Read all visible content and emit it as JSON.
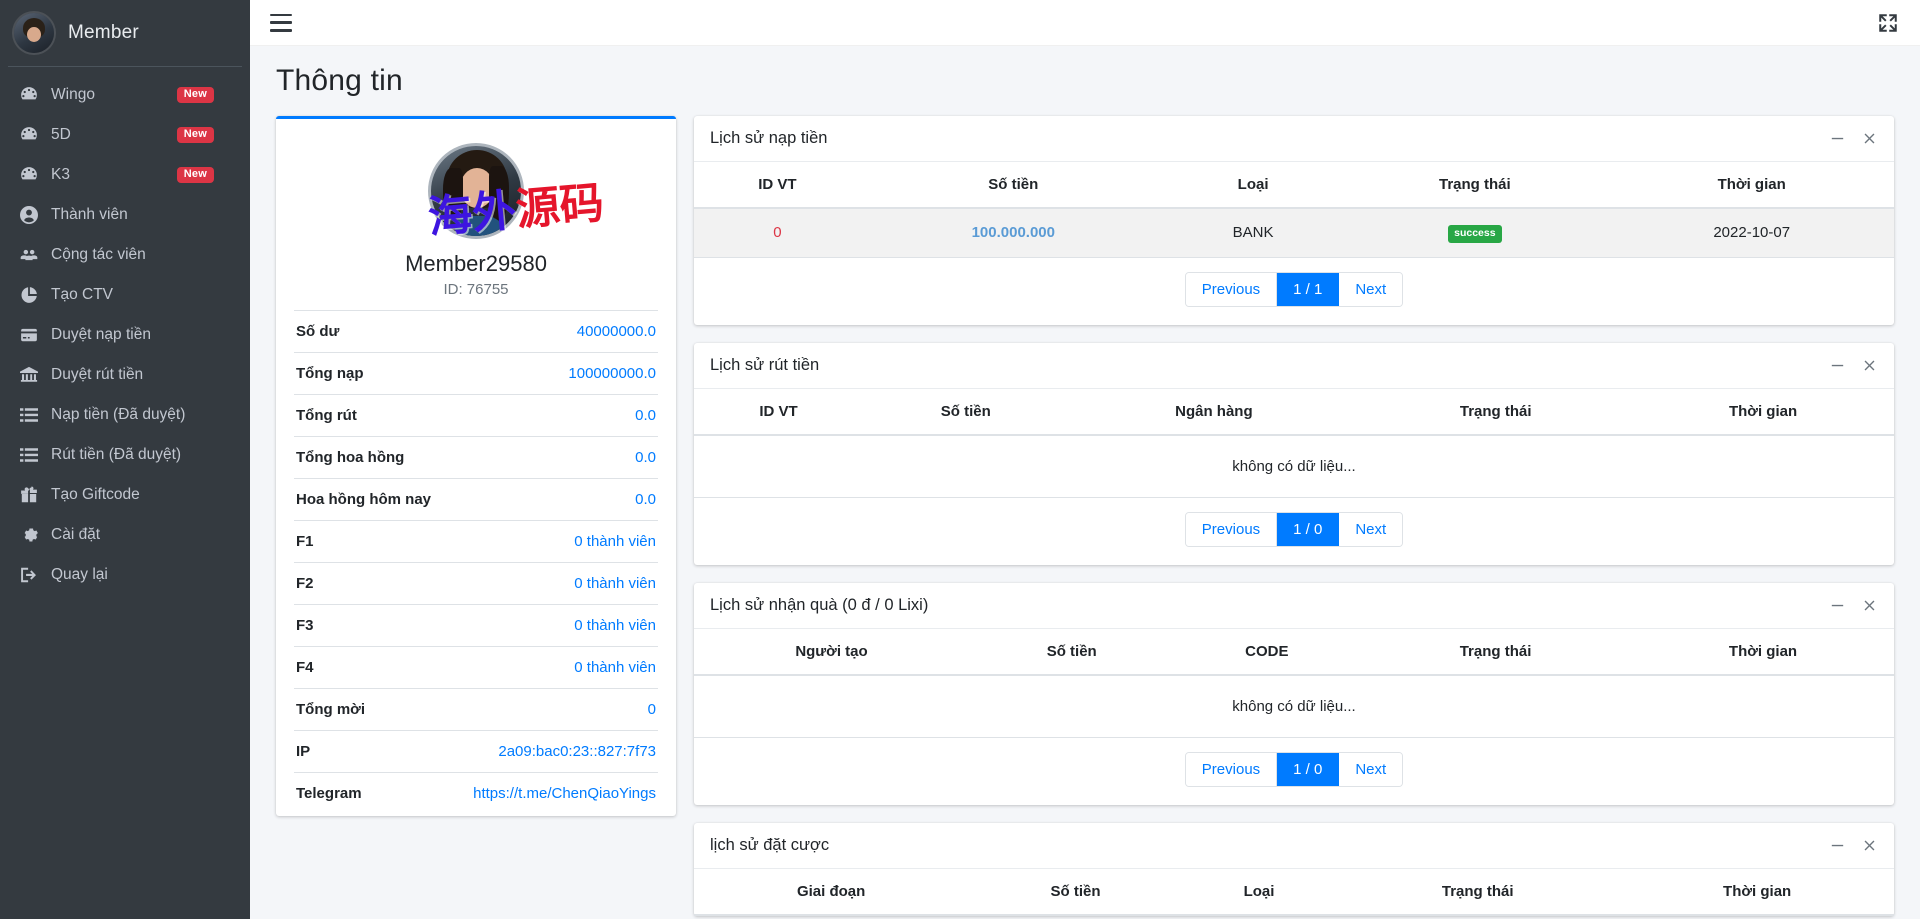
{
  "sidebar": {
    "brand_label": "Member",
    "brand_avatar_icon": "user-avatar-icon",
    "items": [
      {
        "label": "Wingo",
        "icon": "speedometer-icon",
        "badge": "New"
      },
      {
        "label": "5D",
        "icon": "speedometer-icon",
        "badge": "New"
      },
      {
        "label": "K3",
        "icon": "speedometer-icon",
        "badge": "New"
      },
      {
        "label": "Thành viên",
        "icon": "user-circle-icon",
        "badge": ""
      },
      {
        "label": "Cộng tác viên",
        "icon": "users-group-icon",
        "badge": ""
      },
      {
        "label": "Tạo CTV",
        "icon": "pie-chart-icon",
        "badge": ""
      },
      {
        "label": "Duyệt nạp tiền",
        "icon": "credit-card-icon",
        "badge": ""
      },
      {
        "label": "Duyệt rút tiền",
        "icon": "bank-icon",
        "badge": ""
      },
      {
        "label": "Nạp tiền (Đã duyệt)",
        "icon": "list-icon",
        "badge": ""
      },
      {
        "label": "Rút tiền (Đã duyệt)",
        "icon": "list-icon",
        "badge": ""
      },
      {
        "label": "Tạo Giftcode",
        "icon": "gift-icon",
        "badge": ""
      },
      {
        "label": "Cài đặt",
        "icon": "gear-icon",
        "badge": ""
      },
      {
        "label": "Quay lại",
        "icon": "logout-icon",
        "badge": ""
      }
    ]
  },
  "topbar": {
    "menu_icon": "hamburger-icon",
    "expand_icon": "expand-arrows-icon"
  },
  "page": {
    "title": "Thông tin"
  },
  "profile": {
    "avatar_icon": "member-avatar-icon",
    "name": "Member29580",
    "id_label": "ID: 76755",
    "watermark_blue": "海外",
    "watermark_red": "源码",
    "stats": [
      {
        "key": "Số dư",
        "value": "40000000.0"
      },
      {
        "key": "Tổng nạp",
        "value": "100000000.0"
      },
      {
        "key": "Tổng rút",
        "value": "0.0"
      },
      {
        "key": "Tổng hoa hồng",
        "value": "0.0"
      },
      {
        "key": "Hoa hồng hôm nay",
        "value": "0.0"
      },
      {
        "key": "F1",
        "value": "0 thành viên"
      },
      {
        "key": "F2",
        "value": "0 thành viên"
      },
      {
        "key": "F3",
        "value": "0 thành viên"
      },
      {
        "key": "F4",
        "value": "0 thành viên"
      },
      {
        "key": "Tổng mời",
        "value": "0"
      },
      {
        "key": "IP",
        "value": "2a09:bac0:23::827:7f73"
      },
      {
        "key": "Telegram",
        "value": "https://t.me/ChenQiaoYings"
      }
    ]
  },
  "pager": {
    "previous": "Previous",
    "next": "Next"
  },
  "cards": {
    "deposit_history": {
      "title": "Lịch sử nạp tiền",
      "minimize_icon": "minus-icon",
      "close_icon": "close-icon",
      "columns": [
        "ID VT",
        "Số tiền",
        "Loại",
        "Trạng thái",
        "Thời gian"
      ],
      "rows": [
        {
          "id": "0",
          "amount": "100.000.000",
          "type": "BANK",
          "status": "success",
          "time": "2022-10-07"
        }
      ],
      "page_label": "1 / 1",
      "empty_text": ""
    },
    "withdraw_history": {
      "title": "Lịch sử rút tiền",
      "minimize_icon": "minus-icon",
      "close_icon": "close-icon",
      "columns": [
        "ID VT",
        "Số tiền",
        "Ngân hàng",
        "Trạng thái",
        "Thời gian"
      ],
      "rows": [],
      "page_label": "1 / 0",
      "empty_text": "không có dữ liệu..."
    },
    "gift_history": {
      "title": "Lịch sử nhận quà (0 đ / 0 Lixi)",
      "minimize_icon": "minus-icon",
      "close_icon": "close-icon",
      "columns": [
        "Người tạo",
        "Số tiền",
        "CODE",
        "Trạng thái",
        "Thời gian"
      ],
      "rows": [],
      "page_label": "1 / 0",
      "empty_text": "không có dữ liệu..."
    },
    "bet_history": {
      "title": "lịch sử đặt cược",
      "minimize_icon": "minus-icon",
      "close_icon": "close-icon",
      "columns": [
        "Giai đoạn",
        "Số tiền",
        "Loại",
        "Trạng thái",
        "Thời gian"
      ],
      "rows": [],
      "page_label": "",
      "empty_text": ""
    }
  },
  "colors": {
    "sidebar_bg": "#343a40",
    "accent": "#007bff",
    "badge_new": "#dc3545",
    "badge_success": "#28a745"
  }
}
